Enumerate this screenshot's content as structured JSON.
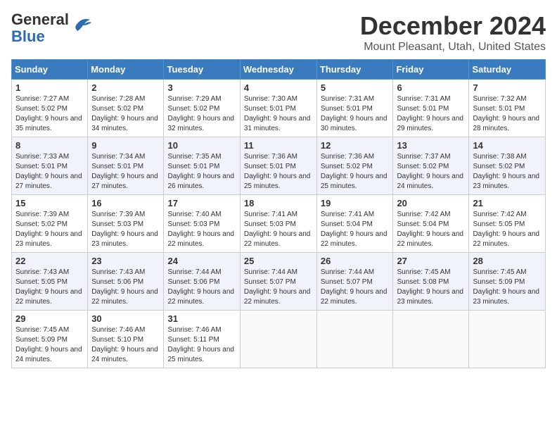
{
  "logo": {
    "general": "General",
    "blue": "Blue"
  },
  "title": "December 2024",
  "subtitle": "Mount Pleasant, Utah, United States",
  "weekdays": [
    "Sunday",
    "Monday",
    "Tuesday",
    "Wednesday",
    "Thursday",
    "Friday",
    "Saturday"
  ],
  "weeks": [
    [
      {
        "day": "1",
        "sunrise": "7:27 AM",
        "sunset": "5:02 PM",
        "daylight": "9 hours and 35 minutes."
      },
      {
        "day": "2",
        "sunrise": "7:28 AM",
        "sunset": "5:02 PM",
        "daylight": "9 hours and 34 minutes."
      },
      {
        "day": "3",
        "sunrise": "7:29 AM",
        "sunset": "5:02 PM",
        "daylight": "9 hours and 32 minutes."
      },
      {
        "day": "4",
        "sunrise": "7:30 AM",
        "sunset": "5:01 PM",
        "daylight": "9 hours and 31 minutes."
      },
      {
        "day": "5",
        "sunrise": "7:31 AM",
        "sunset": "5:01 PM",
        "daylight": "9 hours and 30 minutes."
      },
      {
        "day": "6",
        "sunrise": "7:31 AM",
        "sunset": "5:01 PM",
        "daylight": "9 hours and 29 minutes."
      },
      {
        "day": "7",
        "sunrise": "7:32 AM",
        "sunset": "5:01 PM",
        "daylight": "9 hours and 28 minutes."
      }
    ],
    [
      {
        "day": "8",
        "sunrise": "7:33 AM",
        "sunset": "5:01 PM",
        "daylight": "9 hours and 27 minutes."
      },
      {
        "day": "9",
        "sunrise": "7:34 AM",
        "sunset": "5:01 PM",
        "daylight": "9 hours and 27 minutes."
      },
      {
        "day": "10",
        "sunrise": "7:35 AM",
        "sunset": "5:01 PM",
        "daylight": "9 hours and 26 minutes."
      },
      {
        "day": "11",
        "sunrise": "7:36 AM",
        "sunset": "5:01 PM",
        "daylight": "9 hours and 25 minutes."
      },
      {
        "day": "12",
        "sunrise": "7:36 AM",
        "sunset": "5:02 PM",
        "daylight": "9 hours and 25 minutes."
      },
      {
        "day": "13",
        "sunrise": "7:37 AM",
        "sunset": "5:02 PM",
        "daylight": "9 hours and 24 minutes."
      },
      {
        "day": "14",
        "sunrise": "7:38 AM",
        "sunset": "5:02 PM",
        "daylight": "9 hours and 23 minutes."
      }
    ],
    [
      {
        "day": "15",
        "sunrise": "7:39 AM",
        "sunset": "5:02 PM",
        "daylight": "9 hours and 23 minutes."
      },
      {
        "day": "16",
        "sunrise": "7:39 AM",
        "sunset": "5:03 PM",
        "daylight": "9 hours and 23 minutes."
      },
      {
        "day": "17",
        "sunrise": "7:40 AM",
        "sunset": "5:03 PM",
        "daylight": "9 hours and 22 minutes."
      },
      {
        "day": "18",
        "sunrise": "7:41 AM",
        "sunset": "5:03 PM",
        "daylight": "9 hours and 22 minutes."
      },
      {
        "day": "19",
        "sunrise": "7:41 AM",
        "sunset": "5:04 PM",
        "daylight": "9 hours and 22 minutes."
      },
      {
        "day": "20",
        "sunrise": "7:42 AM",
        "sunset": "5:04 PM",
        "daylight": "9 hours and 22 minutes."
      },
      {
        "day": "21",
        "sunrise": "7:42 AM",
        "sunset": "5:05 PM",
        "daylight": "9 hours and 22 minutes."
      }
    ],
    [
      {
        "day": "22",
        "sunrise": "7:43 AM",
        "sunset": "5:05 PM",
        "daylight": "9 hours and 22 minutes."
      },
      {
        "day": "23",
        "sunrise": "7:43 AM",
        "sunset": "5:06 PM",
        "daylight": "9 hours and 22 minutes."
      },
      {
        "day": "24",
        "sunrise": "7:44 AM",
        "sunset": "5:06 PM",
        "daylight": "9 hours and 22 minutes."
      },
      {
        "day": "25",
        "sunrise": "7:44 AM",
        "sunset": "5:07 PM",
        "daylight": "9 hours and 22 minutes."
      },
      {
        "day": "26",
        "sunrise": "7:44 AM",
        "sunset": "5:07 PM",
        "daylight": "9 hours and 22 minutes."
      },
      {
        "day": "27",
        "sunrise": "7:45 AM",
        "sunset": "5:08 PM",
        "daylight": "9 hours and 23 minutes."
      },
      {
        "day": "28",
        "sunrise": "7:45 AM",
        "sunset": "5:09 PM",
        "daylight": "9 hours and 23 minutes."
      }
    ],
    [
      {
        "day": "29",
        "sunrise": "7:45 AM",
        "sunset": "5:09 PM",
        "daylight": "9 hours and 24 minutes."
      },
      {
        "day": "30",
        "sunrise": "7:46 AM",
        "sunset": "5:10 PM",
        "daylight": "9 hours and 24 minutes."
      },
      {
        "day": "31",
        "sunrise": "7:46 AM",
        "sunset": "5:11 PM",
        "daylight": "9 hours and 25 minutes."
      },
      null,
      null,
      null,
      null
    ]
  ]
}
